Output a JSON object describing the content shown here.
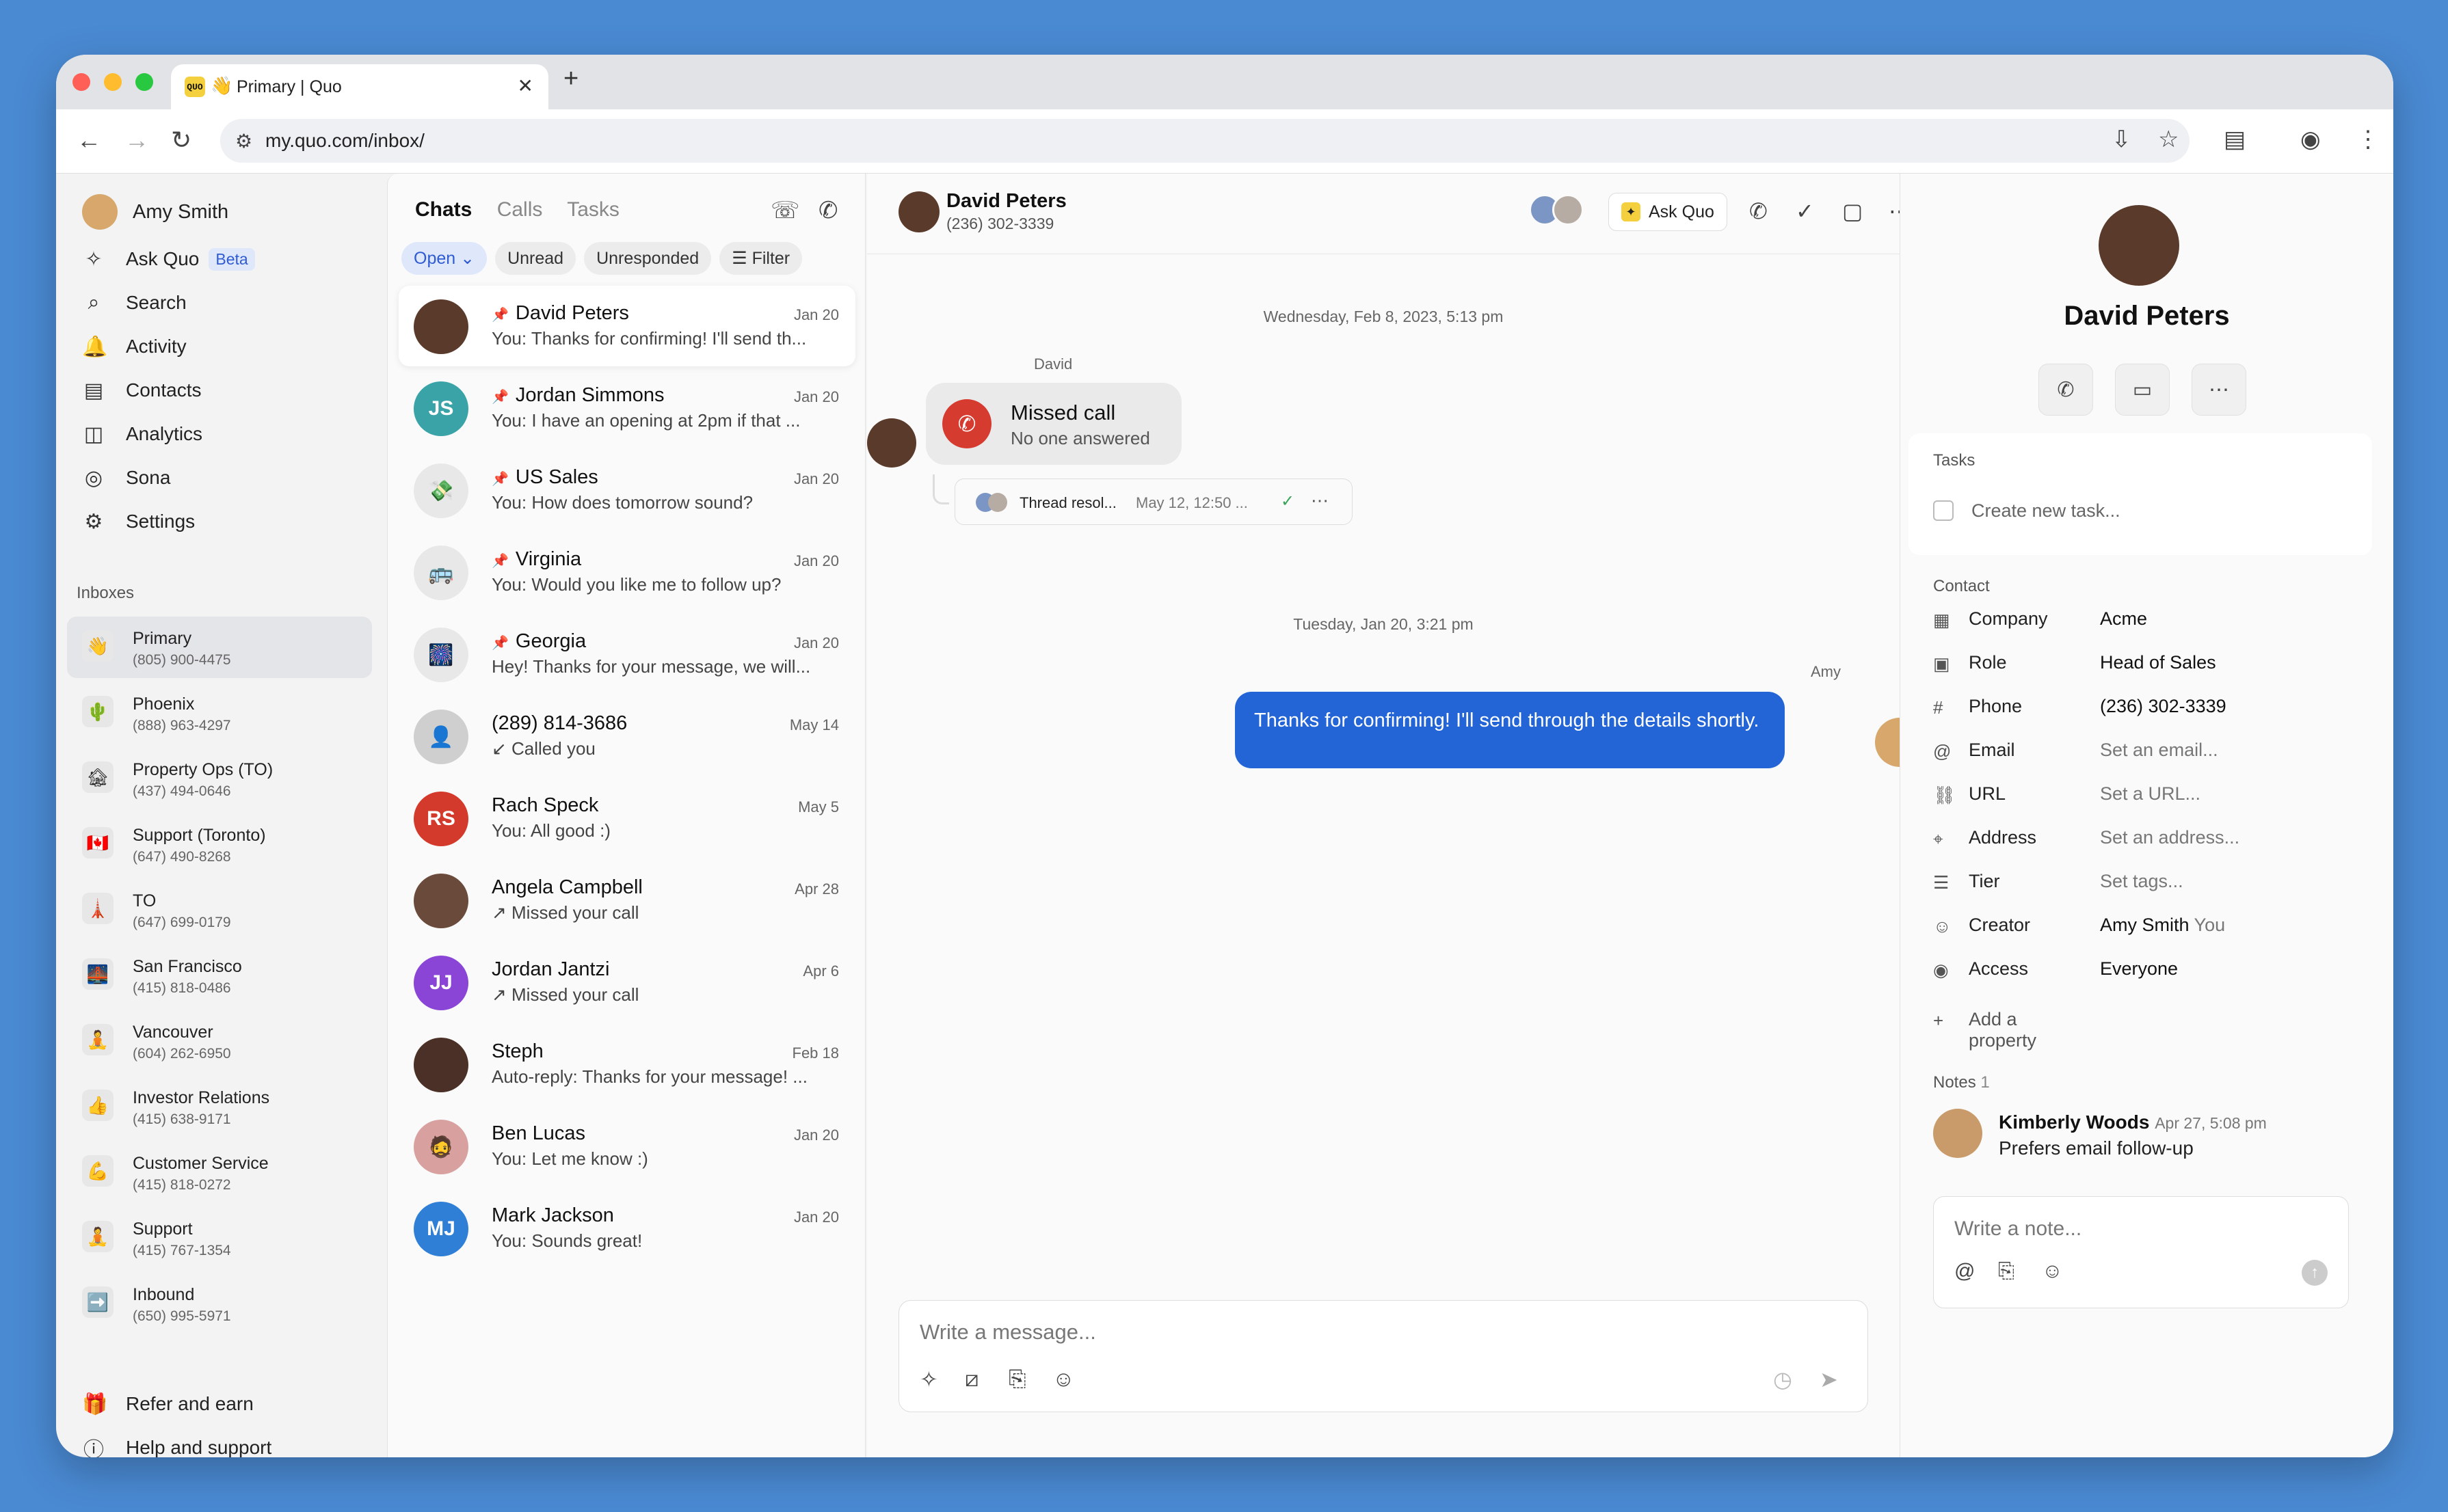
{
  "browser": {
    "tab_title": "Primary | Quo",
    "tab_favicon": "QUO",
    "tab_emoji": "👋",
    "url": "my.quo.com/inbox/"
  },
  "sidebar": {
    "user_name": "Amy Smith",
    "nav": [
      {
        "label": "Ask Quo",
        "icon": "sparkle-icon",
        "badge": "Beta"
      },
      {
        "label": "Search",
        "icon": "search-icon"
      },
      {
        "label": "Activity",
        "icon": "bell-icon"
      },
      {
        "label": "Contacts",
        "icon": "contacts-icon"
      },
      {
        "label": "Analytics",
        "icon": "analytics-icon"
      },
      {
        "label": "Sona",
        "icon": "sona-icon"
      },
      {
        "label": "Settings",
        "icon": "gear-icon"
      }
    ],
    "inboxes_label": "Inboxes",
    "inboxes": [
      {
        "name": "Primary",
        "number": "(805) 900-4475",
        "emoji": "👋"
      },
      {
        "name": "Phoenix",
        "number": "(888) 963-4297",
        "emoji": "🌵"
      },
      {
        "name": "Property Ops (TO)",
        "number": "(437) 494-0646",
        "emoji": "🏚"
      },
      {
        "name": "Support (Toronto)",
        "number": "(647) 490-8268",
        "emoji": "🇨🇦"
      },
      {
        "name": "TO",
        "number": "(647) 699-0179",
        "emoji": "🗼"
      },
      {
        "name": "San Francisco",
        "number": "(415) 818-0486",
        "emoji": "🌉"
      },
      {
        "name": "Vancouver",
        "number": "(604) 262-6950",
        "emoji": "🧘"
      },
      {
        "name": "Investor Relations",
        "number": "(415) 638-9171",
        "emoji": "👍"
      },
      {
        "name": "Customer Service",
        "number": "(415) 818-0272",
        "emoji": "💪"
      },
      {
        "name": "Support",
        "number": "(415) 767-1354",
        "emoji": "🧘"
      },
      {
        "name": "Inbound",
        "number": "(650) 995-5971",
        "emoji": "➡️"
      }
    ],
    "refer": "Refer and earn",
    "help": "Help and support"
  },
  "chats": {
    "tabs": [
      "Chats",
      "Calls",
      "Tasks"
    ],
    "filters": {
      "open": "Open",
      "unread": "Unread",
      "unresponded": "Unresponded",
      "filter": "Filter"
    },
    "items": [
      {
        "name": "David Peters",
        "preview": "You: Thanks for confirming! I'll send th...",
        "date": "Jan 20",
        "pinned": true,
        "avatar_color": "#5a3a2a",
        "initials": ""
      },
      {
        "name": "Jordan Simmons",
        "preview": "You: I have an opening at 2pm if that ...",
        "date": "Jan 20",
        "pinned": true,
        "avatar_color": "#3aa3a8",
        "initials": "JS"
      },
      {
        "name": "US Sales",
        "preview": "You: How does tomorrow sound?",
        "date": "Jan 20",
        "pinned": true,
        "avatar_color": "#e8e8e8",
        "initials": "💸"
      },
      {
        "name": "Virginia",
        "preview": "You: Would you like me to follow up?",
        "date": "Jan 20",
        "pinned": true,
        "avatar_color": "#e8e8e8",
        "initials": "🚌"
      },
      {
        "name": "Georgia",
        "preview": "Hey! Thanks for your message, we will...",
        "date": "Jan 20",
        "pinned": true,
        "avatar_color": "#e8e8e8",
        "initials": "🎆"
      },
      {
        "name": "(289) 814-3686",
        "preview": "↙ Called you",
        "date": "May 14",
        "pinned": false,
        "avatar_color": "#cfcfcf",
        "initials": "👤"
      },
      {
        "name": "Rach Speck",
        "preview": "You: All good :)",
        "date": "May 5",
        "pinned": false,
        "avatar_color": "#d33a2c",
        "initials": "RS"
      },
      {
        "name": "Angela Campbell",
        "preview": "↗ Missed your call",
        "date": "Apr 28",
        "pinned": false,
        "avatar_color": "#6a4a3a",
        "initials": ""
      },
      {
        "name": "Jordan Jantzi",
        "preview": "↗ Missed your call",
        "date": "Apr 6",
        "pinned": false,
        "avatar_color": "#8a44d6",
        "initials": "JJ"
      },
      {
        "name": "Steph",
        "preview": "Auto-reply: Thanks for your message! ...",
        "date": "Feb 18",
        "pinned": false,
        "avatar_color": "#4a3026",
        "initials": ""
      },
      {
        "name": "Ben Lucas",
        "preview": "You: Let me know :)",
        "date": "Jan 20",
        "pinned": false,
        "avatar_color": "#d9a0a0",
        "initials": "🧔"
      },
      {
        "name": "Mark Jackson",
        "preview": "You: Sounds great!",
        "date": "Jan 20",
        "pinned": false,
        "avatar_color": "#2f7fd6",
        "initials": "MJ"
      }
    ]
  },
  "conversation": {
    "name": "David Peters",
    "phone": "(236) 302-3339",
    "ask_quo": "Ask Quo",
    "date1": "Wednesday, Feb 8, 2023, 5:13 pm",
    "sender1": "David",
    "missed_title": "Missed call",
    "missed_sub": "No one answered",
    "thread_text": "Thread resol...",
    "thread_date": "May 12, 12:50 ...",
    "date2": "Tuesday, Jan 20, 3:21 pm",
    "sender2": "Amy",
    "message": "Thanks for confirming! I'll send through the details shortly.",
    "composer_placeholder": "Write a message..."
  },
  "contact": {
    "name": "David Peters",
    "tasks_label": "Tasks",
    "task_placeholder": "Create new task...",
    "contact_label": "Contact",
    "props": [
      {
        "key": "Company",
        "value": "Acme",
        "placeholder": false,
        "icon": "building-icon"
      },
      {
        "key": "Role",
        "value": "Head of Sales",
        "placeholder": false,
        "icon": "badge-icon"
      },
      {
        "key": "Phone",
        "value": "(236) 302-3339",
        "placeholder": false,
        "icon": "hash-icon"
      },
      {
        "key": "Email",
        "value": "Set an email...",
        "placeholder": true,
        "icon": "at-icon"
      },
      {
        "key": "URL",
        "value": "Set a URL...",
        "placeholder": true,
        "icon": "link-icon"
      },
      {
        "key": "Address",
        "value": "Set an address...",
        "placeholder": true,
        "icon": "pin-icon"
      },
      {
        "key": "Tier",
        "value": "Set tags...",
        "placeholder": true,
        "icon": "list-icon"
      },
      {
        "key": "Creator",
        "value": "Amy Smith",
        "suffix": "You",
        "placeholder": false,
        "icon": "person-icon"
      },
      {
        "key": "Access",
        "value": "Everyone",
        "placeholder": false,
        "icon": "eye-icon"
      }
    ],
    "add_property": "Add a property",
    "notes_label": "Notes",
    "notes_count": "1",
    "note_author": "Kimberly Woods",
    "note_date": "Apr 27, 5:08 pm",
    "note_text": "Prefers email follow-up",
    "note_placeholder": "Write a note..."
  },
  "colors": {
    "accent": "#2365d6",
    "missed": "#d63b30",
    "brand": "#f4d03f"
  }
}
